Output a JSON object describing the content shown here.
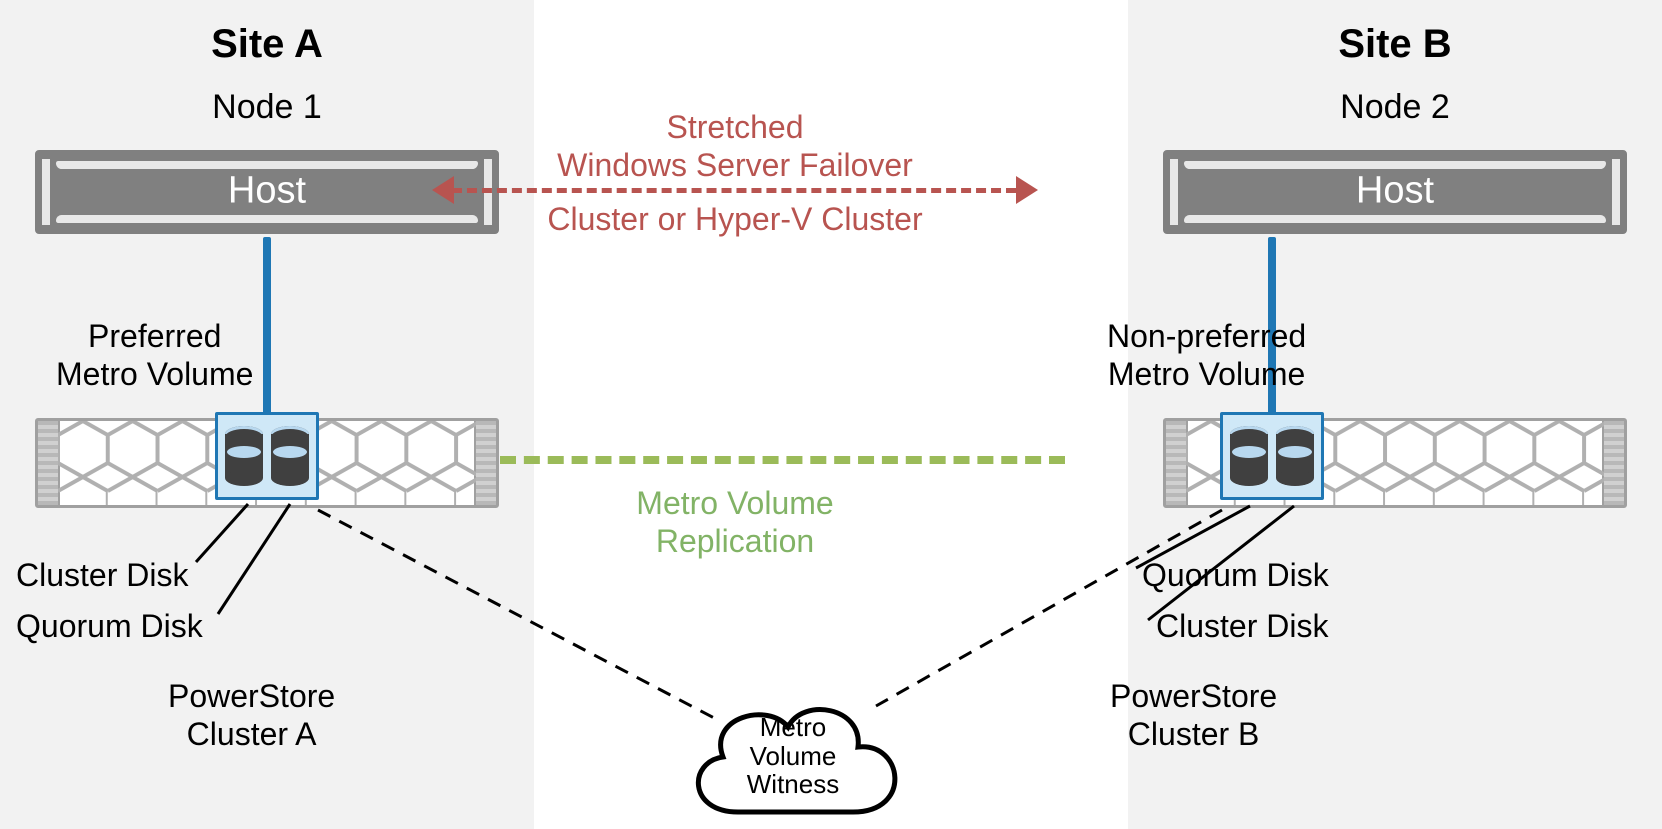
{
  "siteA": {
    "title": "Site A",
    "node": "Node 1",
    "host": "Host",
    "volumeLabel": "Preferred\nMetro Volume",
    "clusterDisk": "Cluster Disk",
    "quorumDisk": "Quorum Disk",
    "clusterName": "PowerStore\nCluster A"
  },
  "siteB": {
    "title": "Site B",
    "node": "Node 2",
    "host": "Host",
    "volumeLabel": "Non-preferred\nMetro Volume",
    "quorumDisk": "Quorum Disk",
    "clusterDisk": "Cluster Disk",
    "clusterName": "PowerStore\nCluster B"
  },
  "center": {
    "stretched1": "Stretched",
    "stretched2": "Windows Server Failover",
    "stretched3": "Cluster or Hyper-V Cluster",
    "replication": "Metro Volume\nReplication",
    "witness": "Metro\nVolume\nWitness"
  }
}
